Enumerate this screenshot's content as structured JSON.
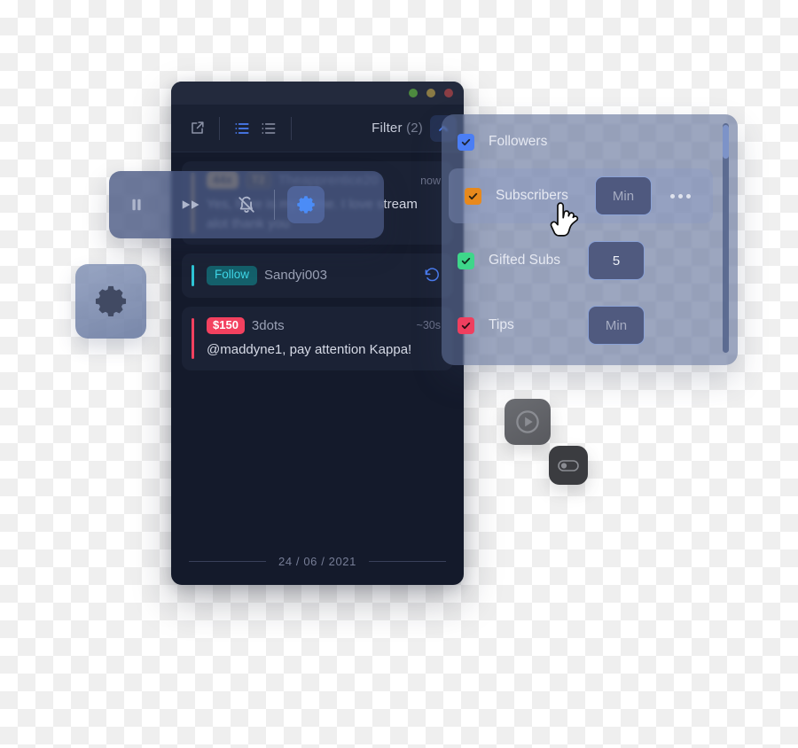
{
  "window": {
    "traffic_lights": [
      "green",
      "yellow",
      "red"
    ]
  },
  "toolbar": {
    "popout_icon": "external-link-icon",
    "list_dense_icon": "list-dense-icon",
    "list_sparse_icon": "list-sparse-icon",
    "filter_label": "Filter",
    "filter_count": "(2)",
    "filter_chevron_icon": "chevron-up-icon"
  },
  "playback_toolbar": {
    "pause_icon": "pause-icon",
    "fast_forward_icon": "fast-forward-icon",
    "bell_muted_icon": "bell-muted-icon",
    "gear_icon": "gear-icon"
  },
  "gear_tile": {
    "icon": "gear-icon"
  },
  "messages": [
    {
      "type": "chat",
      "badges": [
        {
          "text": "44x",
          "style": "amber"
        },
        {
          "text": "T2",
          "style": "tier"
        }
      ],
      "username": "Theapprentice20",
      "time": "now",
      "body": "Yes, here is my prime. I love stream alot thank you",
      "accent": "#f5c25b"
    },
    {
      "type": "follow",
      "badges": [
        {
          "text": "Follow",
          "style": "follow"
        }
      ],
      "username": "Sandyi003",
      "time": "",
      "body": "",
      "accent": "#2ec5d6",
      "action_icon": "replay-icon"
    },
    {
      "type": "tip",
      "badges": [
        {
          "text": "$150",
          "style": "money"
        }
      ],
      "username": "3dots",
      "time": "~30s",
      "body": "@maddyne1, pay attention Kappa!",
      "accent": "#f3415f"
    }
  ],
  "date_divider": {
    "date": "24 / 06 / 2021"
  },
  "filter_panel": {
    "rows": [
      {
        "label": "Followers",
        "checkbox_color": "#4b7ef5",
        "checked": true,
        "has_input": false,
        "input_value": "",
        "input_placeholder": "",
        "has_more": false
      },
      {
        "label": "Subscribers",
        "checkbox_color": "#e8891c",
        "checked": true,
        "has_input": true,
        "input_value": "",
        "input_placeholder": "Min",
        "has_more": true,
        "highlighted": true
      },
      {
        "label": "Gifted Subs",
        "checkbox_color": "#3ed68a",
        "checked": true,
        "has_input": true,
        "input_value": "5",
        "input_placeholder": "",
        "has_more": false
      },
      {
        "label": "Tips",
        "checkbox_color": "#ef3f5f",
        "checked": true,
        "has_input": true,
        "input_value": "",
        "input_placeholder": "Min",
        "has_more": false
      }
    ],
    "more_icon": "ellipsis-icon",
    "scrollbar": "vertical-scrollbar"
  },
  "mini_tiles": [
    {
      "icon": "play-circle-icon"
    },
    {
      "icon": "toggle-switch-icon"
    }
  ],
  "cursor": {
    "icon": "pointing-hand-cursor"
  }
}
